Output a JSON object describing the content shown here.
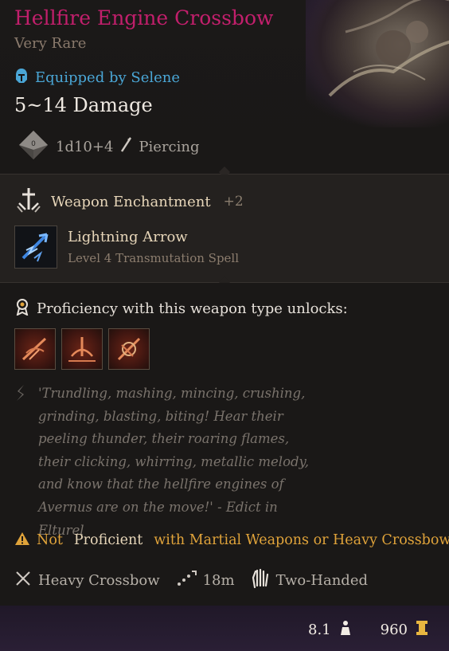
{
  "item": {
    "name": "Hellfire Engine Crossbow",
    "rarity": "Very Rare",
    "equipped_by": "Equipped by Selene",
    "damage": "5~14 Damage",
    "damage_dice": "1d10+4",
    "damage_type": "Piercing"
  },
  "enchantment": {
    "label": "Weapon Enchantment",
    "value": "+2"
  },
  "spell": {
    "name": "Lightning Arrow",
    "description": "Level 4 Transmutation Spell",
    "icon": "lightning-arrow-icon"
  },
  "proficiency": {
    "label": "Proficiency with this weapon type unlocks:",
    "actions": [
      {
        "icon": "piercing-shot-icon"
      },
      {
        "icon": "brace-ranged-icon"
      },
      {
        "icon": "hamstring-shot-icon"
      }
    ]
  },
  "quote": "'Trundling, mashing, mincing, crushing, grinding, blasting, biting! Hear their peeling thunder, their roaring flames, their clicking, whirring, metallic melody, and know that the hellfire engines of Avernus are on the move!' - Edict in Elturel",
  "warning": {
    "not_proficient": "Not",
    "proficient": "Proficient",
    "detail": "with Martial Weapons or Heavy Crossbows"
  },
  "properties": {
    "weapon_type": "Heavy Crossbow",
    "range": "18m",
    "handedness": "Two-Handed"
  },
  "footer": {
    "weight": "8.1",
    "value": "960"
  },
  "colors": {
    "title": "#c21f6c",
    "equipped": "#4aa6d6",
    "warning": "#e0a33a"
  }
}
